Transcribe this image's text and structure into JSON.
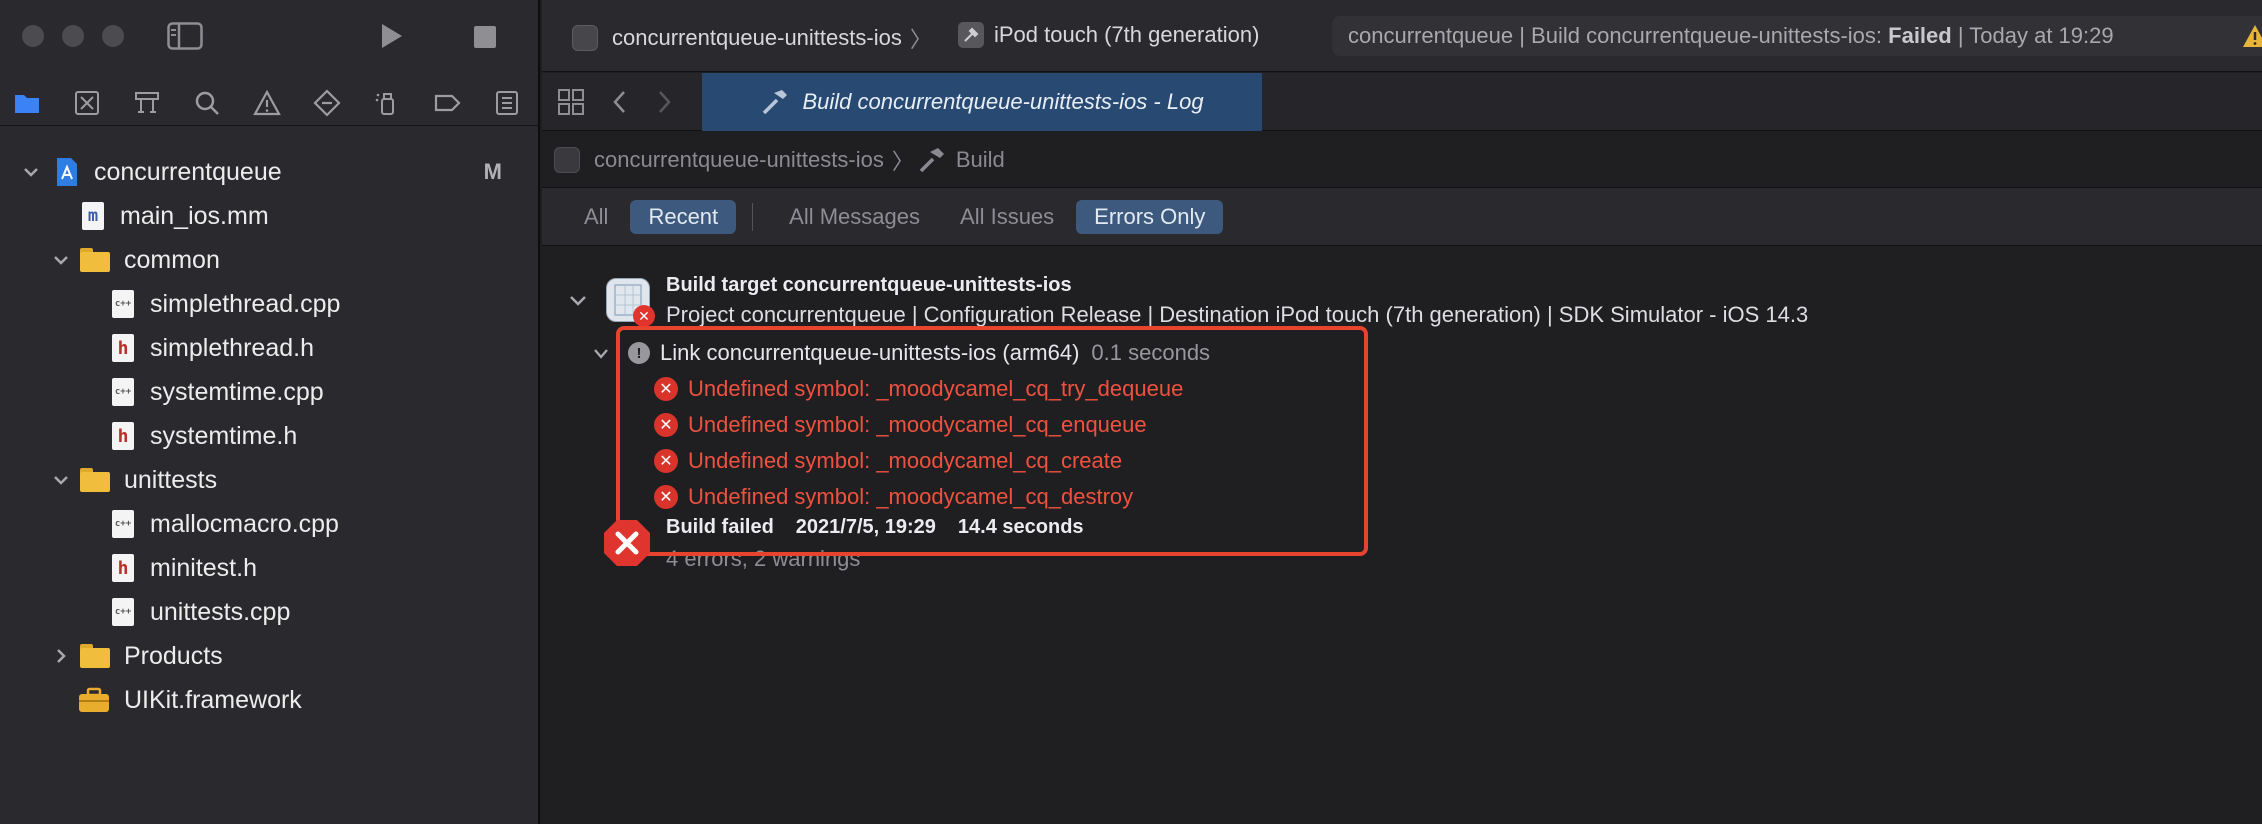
{
  "sidebar": {
    "tree": [
      {
        "label": "concurrentqueue",
        "badge": "M"
      },
      {
        "label": "main_ios.mm",
        "glyph": "m"
      },
      {
        "label": "common"
      },
      {
        "label": "simplethread.cpp",
        "glyph": "c++"
      },
      {
        "label": "simplethread.h",
        "glyph": "h"
      },
      {
        "label": "systemtime.cpp",
        "glyph": "c++"
      },
      {
        "label": "systemtime.h",
        "glyph": "h"
      },
      {
        "label": "unittests"
      },
      {
        "label": "mallocmacro.cpp",
        "glyph": "c++"
      },
      {
        "label": "minitest.h",
        "glyph": "h"
      },
      {
        "label": "unittests.cpp",
        "glyph": "c++"
      },
      {
        "label": "Products"
      },
      {
        "label": "UIKit.framework"
      }
    ]
  },
  "titlebar": {
    "scheme": "concurrentqueue-unittests-ios",
    "device": "iPod touch (7th generation)",
    "activity_prefix": "concurrentqueue | Build concurrentqueue-unittests-ios: ",
    "activity_status": "Failed",
    "activity_suffix": " | Today at 19:29"
  },
  "tab": {
    "title": "Build concurrentqueue-unittests-ios - Log"
  },
  "jumpbar": {
    "target": "concurrentqueue-unittests-ios",
    "action": "Build"
  },
  "filters": {
    "all": "All",
    "recent": "Recent",
    "all_messages": "All Messages",
    "all_issues": "All Issues",
    "errors_only": "Errors Only"
  },
  "log": {
    "target_title": "Build target concurrentqueue-unittests-ios",
    "target_detail": "Project concurrentqueue | Configuration Release | Destination iPod touch (7th generation) | SDK Simulator - iOS 14.3",
    "link_step": "Link concurrentqueue-unittests-ios (arm64)",
    "link_duration": "0.1 seconds",
    "errors": [
      "Undefined symbol: _moodycamel_cq_try_dequeue",
      "Undefined symbol: _moodycamel_cq_enqueue",
      "Undefined symbol: _moodycamel_cq_create",
      "Undefined symbol: _moodycamel_cq_destroy"
    ],
    "result_status": "Build failed",
    "result_date": "2021/7/5, 19:29",
    "result_duration": "14.4 seconds",
    "result_summary": "4 errors, 2 warnings"
  },
  "colors": {
    "error": "#f0513f",
    "highlight_box": "#e8432f",
    "tab_active": "#284a72",
    "filter_active": "#3d5a7e",
    "folder": "#f0be3c"
  }
}
